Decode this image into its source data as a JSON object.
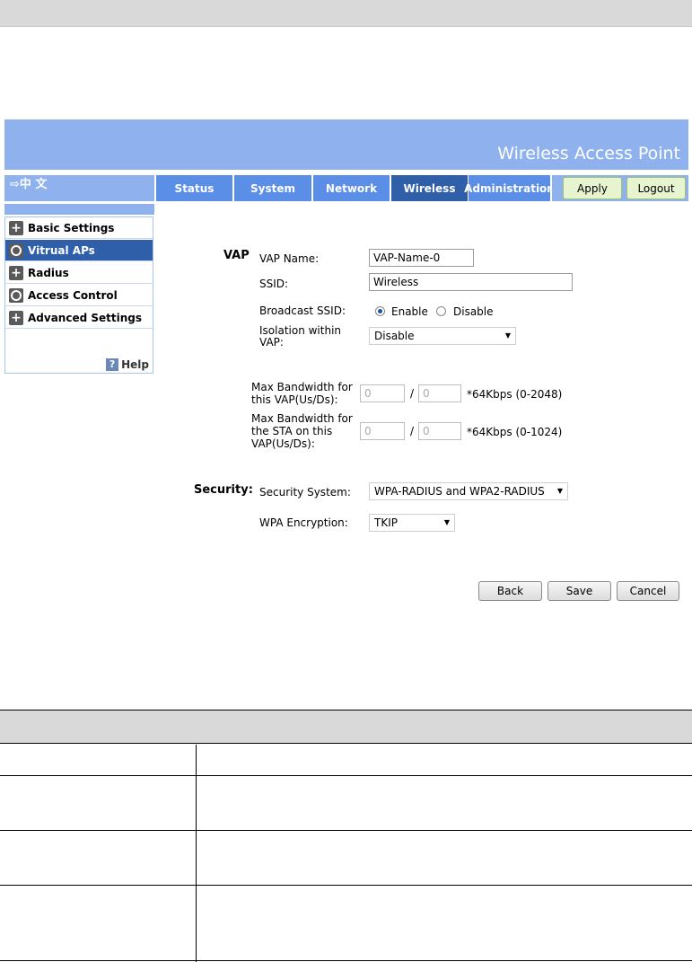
{
  "header": {
    "banner_title": "Wireless Access Point",
    "lang_switch": "⇨中 文"
  },
  "nav": {
    "tabs": [
      {
        "label": "Status"
      },
      {
        "label": "System"
      },
      {
        "label": "Network"
      },
      {
        "label": "Wireless"
      },
      {
        "label": "Administration"
      }
    ],
    "active_tab": "Wireless",
    "apply_label": "Apply",
    "logout_label": "Logout"
  },
  "sidebar": {
    "items": [
      {
        "label": "Basic Settings",
        "icon": "plus-icon"
      },
      {
        "label": "Vitrual APs",
        "icon": "circle-icon"
      },
      {
        "label": "Radius",
        "icon": "plus-icon"
      },
      {
        "label": "Access Control",
        "icon": "circle-icon"
      },
      {
        "label": "Advanced Settings",
        "icon": "plus-icon"
      }
    ],
    "active_item": "Vitrual APs",
    "help_label": "Help",
    "help_icon": "?"
  },
  "form": {
    "vap_section": "VAP",
    "vap_name_label": "VAP Name:",
    "vap_name_value": "VAP-Name-0",
    "ssid_label": "SSID:",
    "ssid_value": "Wireless",
    "broadcast_label": "Broadcast SSID:",
    "enable_label": "Enable",
    "disable_label": "Disable",
    "isolation_label_1": "Isolation within",
    "isolation_label_2": "VAP:",
    "isolation_value": "Disable",
    "maxbw_vap_label_1": "Max Bandwidth for",
    "maxbw_vap_label_2": "this VAP(Us/Ds):",
    "maxbw_vap_up": "0",
    "maxbw_vap_down": "0",
    "maxbw_vap_unit": "*64Kbps (0-2048)",
    "maxbw_sta_label_1": "Max Bandwidth for",
    "maxbw_sta_label_2": "the STA on this",
    "maxbw_sta_label_3": "VAP(Us/Ds):",
    "maxbw_sta_up": "0",
    "maxbw_sta_down": "0",
    "maxbw_sta_unit": "*64Kbps (0-1024)",
    "slash": "/",
    "security_section": "Security:",
    "security_system_label": "Security System:",
    "security_system_value": "WPA-RADIUS and WPA2-RADIUS",
    "wpa_encryption_label": "WPA Encryption:",
    "wpa_encryption_value": "TKIP"
  },
  "buttons": {
    "back": "Back",
    "save": "Save",
    "cancel": "Cancel"
  },
  "colors": {
    "banner": "#8fb1ee",
    "tab": "#5b8ee6",
    "tab_active": "#2f5fa8"
  }
}
